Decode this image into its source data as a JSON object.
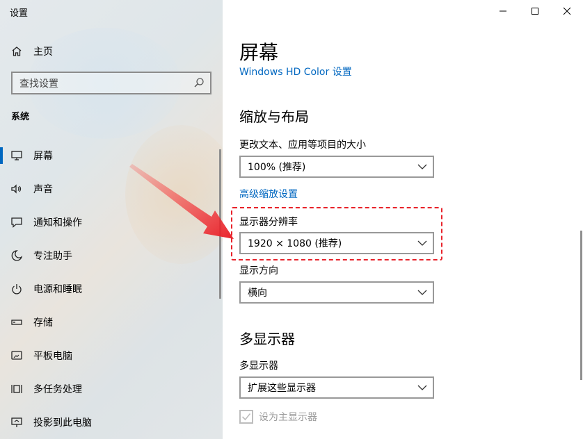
{
  "window": {
    "title": "设置"
  },
  "sidebar": {
    "home_label": "主页",
    "search_placeholder": "查找设置",
    "section": "系统",
    "items": [
      {
        "label": "屏幕",
        "icon": "monitor-icon",
        "active": true
      },
      {
        "label": "声音",
        "icon": "speaker-icon",
        "active": false
      },
      {
        "label": "通知和操作",
        "icon": "notification-icon",
        "active": false
      },
      {
        "label": "专注助手",
        "icon": "moon-icon",
        "active": false
      },
      {
        "label": "电源和睡眠",
        "icon": "power-icon",
        "active": false
      },
      {
        "label": "存储",
        "icon": "storage-icon",
        "active": false
      },
      {
        "label": "平板电脑",
        "icon": "tablet-icon",
        "active": false
      },
      {
        "label": "多任务处理",
        "icon": "multitask-icon",
        "active": false
      },
      {
        "label": "投影到此电脑",
        "icon": "projection-icon",
        "active": false
      }
    ]
  },
  "main": {
    "title": "屏幕",
    "hd_color_link": "Windows HD Color 设置",
    "scale_section_title": "缩放与布局",
    "scale_label": "更改文本、应用等项目的大小",
    "scale_value": "100% (推荐)",
    "advanced_scale_link": "高级缩放设置",
    "resolution_label": "显示器分辨率",
    "resolution_value": "1920 × 1080 (推荐)",
    "orientation_label": "显示方向",
    "orientation_value": "横向",
    "multi_section_title": "多显示器",
    "multi_label": "多显示器",
    "multi_value": "扩展这些显示器",
    "main_display_label": "设为主显示器",
    "main_display_checked": true
  },
  "colors": {
    "accent": "#0067c0",
    "annotation": "#e8222a"
  }
}
